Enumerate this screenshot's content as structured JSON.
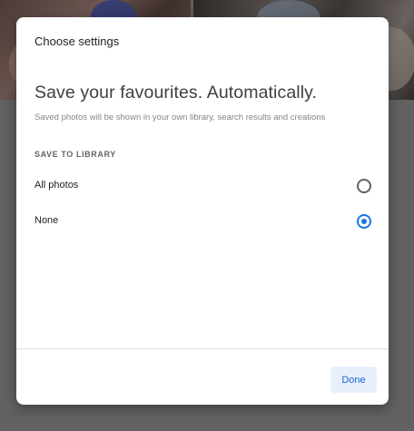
{
  "dialog": {
    "title": "Choose settings",
    "headline": "Save your favourites. Automatically.",
    "description": "Saved photos will be shown in your own library, search results and creations",
    "section_label": "SAVE TO LIBRARY",
    "options": [
      {
        "label": "All photos",
        "selected": false
      },
      {
        "label": "None",
        "selected": true
      }
    ],
    "done_label": "Done"
  },
  "colors": {
    "accent": "#1a73e8",
    "button_bg": "#e8f0fe",
    "overlay": "#5f5f5f"
  }
}
